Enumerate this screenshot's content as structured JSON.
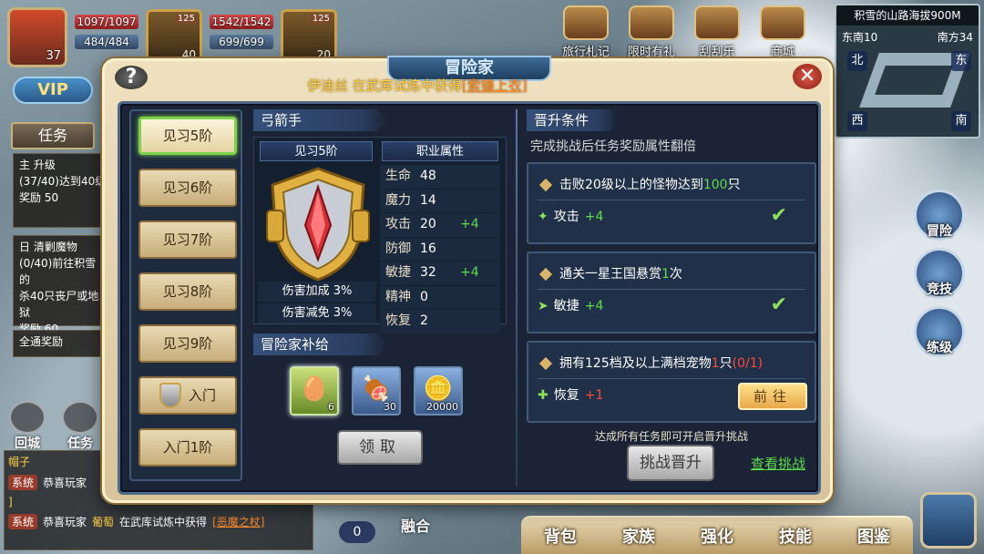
{
  "hud": {
    "player_level": "37",
    "hp": "1097/1097",
    "mp": "484/484",
    "pet1_level": "40",
    "pet1_badge": "125",
    "pet_hp": "1542/1542",
    "pet_mp": "699/699",
    "pet2_level": "20",
    "pet2_badge": "125",
    "vip_label": "VIP"
  },
  "top_icons": [
    {
      "label": "旅行札记",
      "icon": "journal-icon"
    },
    {
      "label": "限时有礼",
      "icon": "gift-icon"
    },
    {
      "label": "刮刮乐",
      "icon": "scratch-card-icon"
    },
    {
      "label": "商城",
      "icon": "shop-icon"
    }
  ],
  "minimap": {
    "title": "积雪的山路海拔900M",
    "coord_east": "东南10",
    "coord_south": "南方34",
    "north": "北",
    "east": "东",
    "west": "西",
    "south": "南"
  },
  "left_hud": {
    "task_tab": "任务",
    "quest1_tag": "主",
    "quest1_title": "升级",
    "quest1_desc": "(37/40)达到40级",
    "quest1_reward": "奖励",
    "quest1_reward_val": "50",
    "quest2_tag": "日",
    "quest2_title": "清剿魔物",
    "quest2_desc": "(0/40)前往积雪的",
    "quest2_desc2": "杀40只丧尸或地狱",
    "quest2_reward": "奖励",
    "quest2_reward_val": "60",
    "all_reward": "全通奖励"
  },
  "bottom_left": [
    {
      "label": "回城",
      "icon": "castle-icon"
    },
    {
      "label": "任务",
      "icon": "quill-icon"
    }
  ],
  "chat": {
    "channel": "帽子",
    "row1_tag": "系统",
    "row1_text": "恭喜玩家",
    "row1_suffix": "]",
    "row2_tag": "系统",
    "row2_prefix": "恭喜玩家",
    "row2_player": "葡萄",
    "row2_text": "在武库试炼中获得",
    "row2_item": "[恶魔之杖]"
  },
  "right_buttons": [
    {
      "label": "冒险",
      "icon": "adventure-icon"
    },
    {
      "label": "竞技",
      "icon": "arena-icon"
    },
    {
      "label": "练级",
      "icon": "training-icon"
    }
  ],
  "bottom_bar": [
    "背包",
    "家族",
    "强化",
    "技能",
    "图鉴"
  ],
  "bottom_misc": {
    "merge": "融合",
    "zero": "0"
  },
  "modal": {
    "title": "冒险家",
    "help": "?",
    "close": "✕",
    "marquee_player": "伊迪丝",
    "marquee_text": "在武库试炼中获得",
    "marquee_item": "[索镰上衣]",
    "ranks": [
      "见习5阶",
      "见习6阶",
      "见习7阶",
      "见习8阶",
      "见习9阶",
      "入门",
      "入门1阶"
    ],
    "active_rank": 0,
    "class_name": "弓箭手",
    "badge_title": "见习5阶",
    "attr_title": "职业属性",
    "damage_up": "伤害加成 3%",
    "damage_down": "伤害减免 3%",
    "attributes": [
      {
        "name": "生命",
        "value": "48",
        "bonus": ""
      },
      {
        "name": "魔力",
        "value": "14",
        "bonus": ""
      },
      {
        "name": "攻击",
        "value": "20",
        "bonus": "+4"
      },
      {
        "name": "防御",
        "value": "16",
        "bonus": ""
      },
      {
        "name": "敏捷",
        "value": "32",
        "bonus": "+4"
      },
      {
        "name": "精神",
        "value": "0",
        "bonus": ""
      },
      {
        "name": "恢复",
        "value": "2",
        "bonus": ""
      }
    ],
    "supply_title": "冒险家补给",
    "supplies": [
      {
        "icon": "egg-icon",
        "count": "6"
      },
      {
        "icon": "meat-icon",
        "count": "30"
      },
      {
        "icon": "coin-icon",
        "count": "20000"
      }
    ],
    "claim_label": "领取",
    "promo_title": "晋升条件",
    "promo_subtitle": "完成挑战后任务奖励属性翻倍",
    "conditions": [
      {
        "pre": "击败20级以上的怪物达到",
        "hl": "100",
        "post": "只",
        "prog": "",
        "reward_name": "攻击",
        "reward_val": "+4",
        "reward_icon": "attack-icon",
        "done": true
      },
      {
        "pre": "通关一星王国悬赏",
        "hl": "1",
        "post": "次",
        "prog": "",
        "reward_name": "敏捷",
        "reward_val": "+4",
        "reward_icon": "agility-icon",
        "done": true
      },
      {
        "pre": "拥有125档及以上满档宠物",
        "hl": "1",
        "post": "只",
        "prog": "(0/1)",
        "reward_name": "恢复",
        "reward_val": "+1",
        "reward_icon": "recovery-icon",
        "done": false
      }
    ],
    "check_mark": "✔",
    "goto_label": "前往",
    "note": "达成所有任务即可开启晋升挑战",
    "challenge_label": "挑战晋升",
    "view_label": "查看挑战"
  }
}
